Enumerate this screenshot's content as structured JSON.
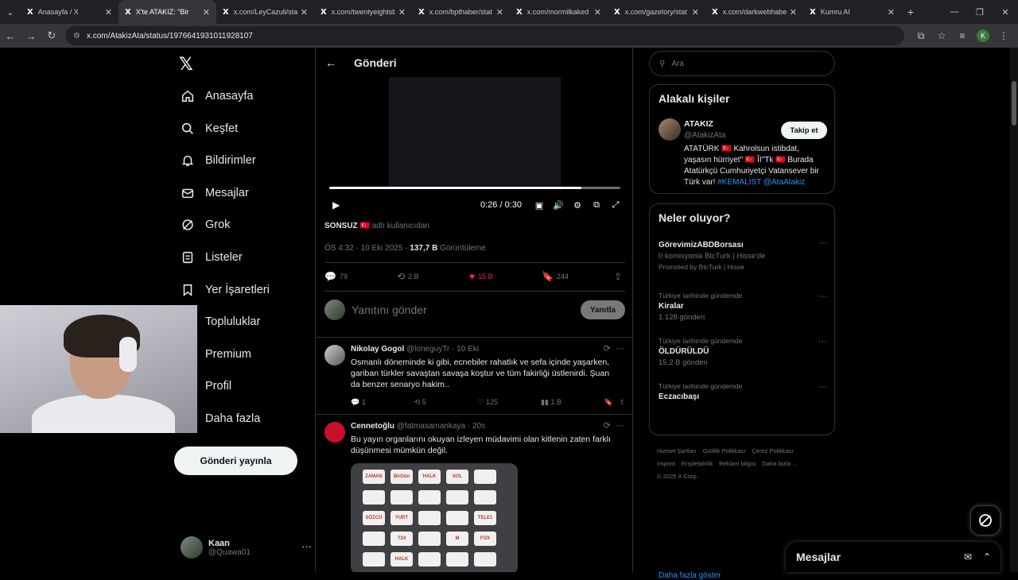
{
  "browser": {
    "tabs": [
      {
        "title": "Anasayfa / X",
        "active": false
      },
      {
        "title": "X'te ATAKIZ: \"Bir",
        "active": true
      },
      {
        "title": "x.com/LeyCazuli/stat",
        "active": false
      },
      {
        "title": "x.com/twentyeightsb",
        "active": false
      },
      {
        "title": "x.com/bpthaber/stat",
        "active": false
      },
      {
        "title": "x.com/mormilkaked",
        "active": false
      },
      {
        "title": "x.com/gazetory/stat",
        "active": false
      },
      {
        "title": "x.com/darkwebhaber",
        "active": false
      },
      {
        "title": "Kumru AI",
        "active": false
      }
    ],
    "url": "x.com/AtakizAta/status/1976641931011928107",
    "profile_initial": "K"
  },
  "nav": {
    "items": [
      {
        "label": "Anasayfa",
        "icon": "home-icon"
      },
      {
        "label": "Keşfet",
        "icon": "search-icon"
      },
      {
        "label": "Bildirimler",
        "icon": "bell-icon"
      },
      {
        "label": "Mesajlar",
        "icon": "mail-icon"
      },
      {
        "label": "Grok",
        "icon": "grok-icon"
      },
      {
        "label": "Listeler",
        "icon": "list-icon"
      },
      {
        "label": "Yer İşaretleri",
        "icon": "bookmark-icon"
      },
      {
        "label": "Topluluklar",
        "icon": "community-icon"
      },
      {
        "label": "Premium",
        "icon": "premium-icon"
      },
      {
        "label": "Profil",
        "icon": "profile-icon"
      },
      {
        "label": "Daha fazla",
        "icon": "more-icon"
      }
    ],
    "post_button": "Gönderi yayınla",
    "me": {
      "name": "Kaan",
      "handle": "@Quawa01"
    }
  },
  "main": {
    "title": "Gönderi",
    "video": {
      "time": "0:26 / 0:30",
      "progress": 0.866
    },
    "source_name": "SONSUZ",
    "source_suffix": "adlı kullanıcıdan",
    "meta_time": "ÖS 4:32 · 10 Eki 2025 · ",
    "meta_views": "137,7 B",
    "meta_views_label": " Görüntüleme",
    "actions": {
      "replies": "79",
      "reposts": "2 B",
      "likes": "15 B",
      "bookmarks": "244"
    },
    "reply_placeholder": "Yanıtını gönder",
    "reply_button": "Yanıtla",
    "replies": [
      {
        "name": "Nikolay Gogol",
        "handle": "@loneguyTr · 10 Eki",
        "text": "Osmanlı döneminde ki gibi, ecnebiler rahatlık ve sefa içinde yaşarken, gariban türkler savaştan savaşa koştur ve tüm fakirliği üstlenirdi. Şuan da benzer senaryo hakim..",
        "replies": "1",
        "reposts": "5",
        "likes": "125",
        "views": "1 B"
      },
      {
        "name": "Cennetoğlu",
        "handle": "@fatmasamankaya · 20s",
        "text": "Bu yayın organlarını okuyan izleyen müdavimi olan kitlenin zaten farklı düşünmesi mümkün değil."
      }
    ],
    "logos": [
      "ZAMAN",
      "BirGün",
      "HALK",
      "SOL",
      "",
      "",
      "",
      "",
      "",
      "",
      "SÖZCÜ",
      "YURT",
      "",
      "",
      "TELE1",
      "",
      "T24",
      "",
      "M",
      "FOX",
      "",
      "HALK",
      "",
      "",
      ""
    ]
  },
  "right": {
    "search_placeholder": "Ara",
    "people_title": "Alakalı kişiler",
    "person": {
      "name": "ATAKIZ",
      "handle": "@AtakizAta",
      "follow": "Takip et",
      "bio": "ATATÜRK 🇹🇷 Kahrolsun istibdat, yaşasın hürriyet\" 🇹🇷 ÎI\"Tk 🇹🇷 Burada Atatürkçü Cumhuriyetçi Vatansever bir Türk var! ",
      "bio_link": "#KEMALİST @AtaAtakiz"
    },
    "trends_title": "Neler oluyor?",
    "trends": [
      {
        "context": "",
        "name": "GörevimizABDBorsası",
        "sub": "0 komisyonla BtcTurk | Hisse'de",
        "promo": "Promoted by BtcTurk | Hisse"
      },
      {
        "context": "Türkiye tarihinde gündemde",
        "name": "Kiralar",
        "sub": "1.128 gönderi",
        "promo": ""
      },
      {
        "context": "Türkiye tarihinde gündemde",
        "name": "ÖLDÜRÜLDÜ",
        "sub": "15,2 B gönderi",
        "promo": ""
      },
      {
        "context": "Türkiye tarihinde gündemde",
        "name": "Eczacıbaşı",
        "sub": "",
        "promo": ""
      }
    ],
    "show_more": "Daha fazla göster",
    "footer": [
      "Hizmet Şartları",
      "Gizlilik Politikası",
      "Çerez Politikası",
      "Imprint",
      "Erişilebilirlik",
      "Reklam bilgisi",
      "Daha fazla ...",
      "© 2025 X Corp."
    ]
  },
  "messages_drawer": {
    "title": "Mesajlar"
  }
}
